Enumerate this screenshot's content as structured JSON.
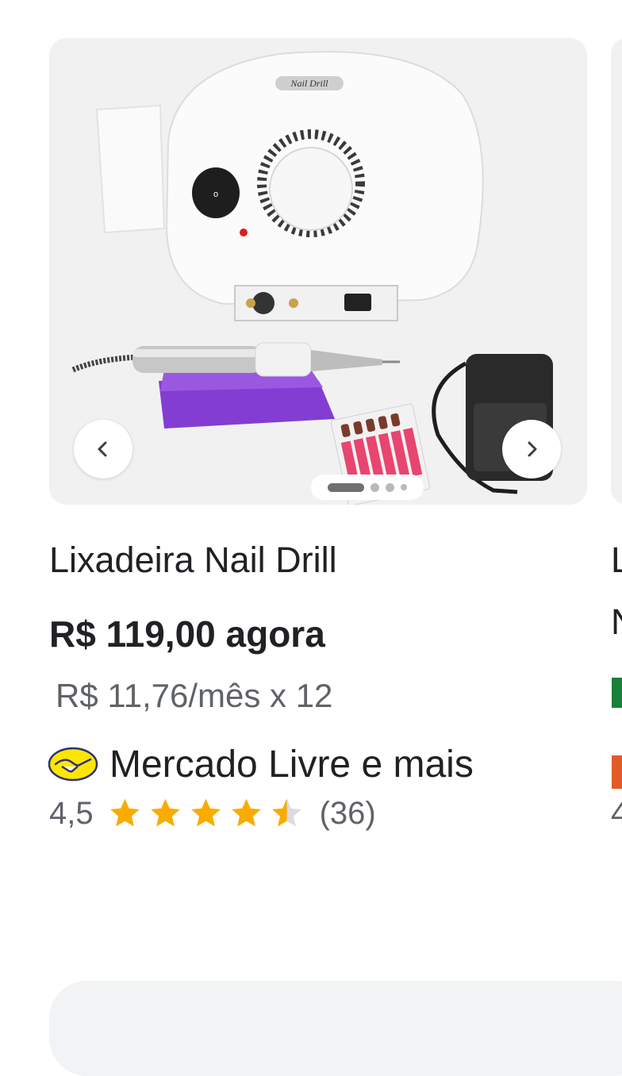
{
  "product": {
    "title": "Lixadeira Nail Drill",
    "price": "R$ 119,00 agora",
    "installment": "R$ 11,76/mês x 12",
    "seller": "Mercado Livre e mais",
    "rating_value": "4,5",
    "rating": 4.5,
    "rating_max": 5,
    "review_count": "(36)",
    "device_label": "Nail Drill"
  },
  "carousel": {
    "total_images": 4,
    "active_index": 0,
    "prev_icon": "chevron-left-icon",
    "next_icon": "chevron-right-icon"
  },
  "colors": {
    "star": "#f9ab00",
    "star_empty": "#dadce0",
    "peek_price": "#188038",
    "peek_seller": "#e25b26"
  },
  "next_card_peek": {
    "title_letter_1": "L",
    "title_letter_2": "N",
    "rating_letter": "4"
  }
}
